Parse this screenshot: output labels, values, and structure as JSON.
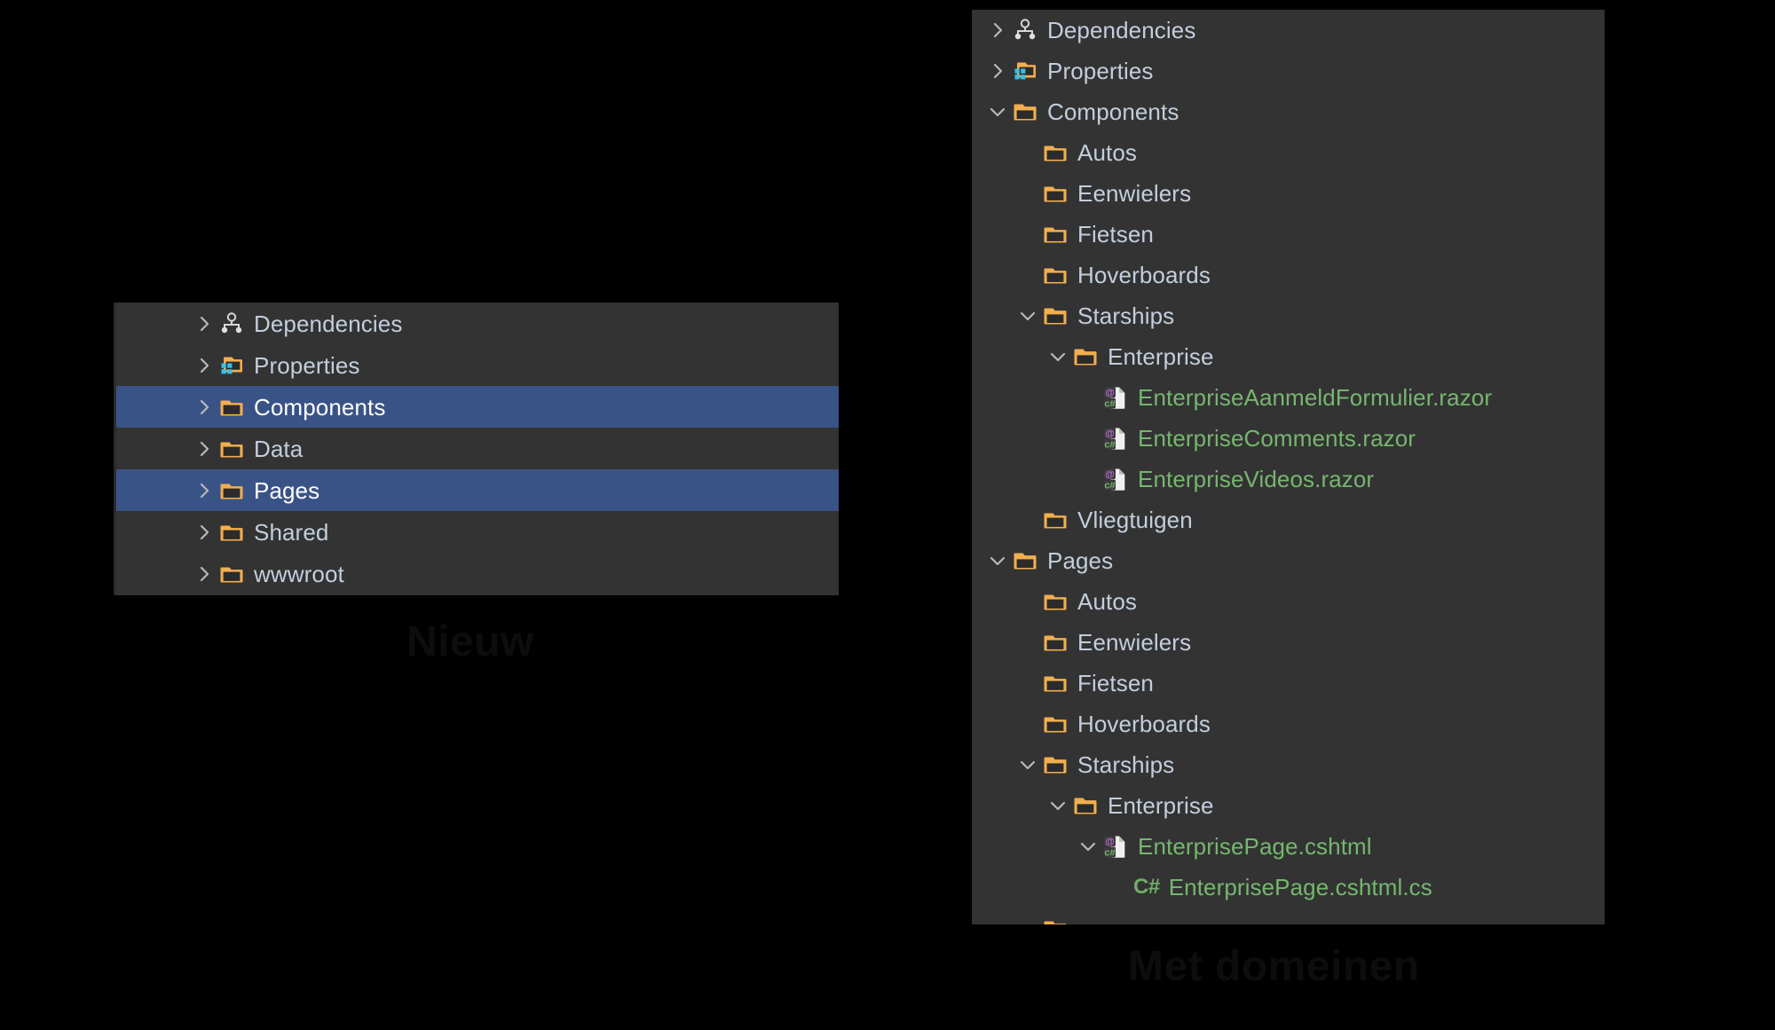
{
  "colors": {
    "background": "#000000",
    "panel_background": "#333333",
    "selection_blue": "#3a5387",
    "folder_orange": "#f2ae4f",
    "text_default": "#c3cedd",
    "text_selected": "#ffffff",
    "file_green": "#76b66f",
    "razor_purple": "#c06fd6",
    "properties_cyan": "#39c0e8",
    "caption_text": "#0d0d0d"
  },
  "captions": {
    "left": "Nieuw",
    "right": "Met domeinen"
  },
  "panel_new": {
    "title": "Nieuw",
    "rows": [
      {
        "label": "Dependencies",
        "icon": "dependencies-icon",
        "chevron": "collapsed",
        "depth": 0,
        "selected": false
      },
      {
        "label": "Properties",
        "icon": "properties-folder-icon",
        "chevron": "collapsed",
        "depth": 0,
        "selected": false
      },
      {
        "label": "Components",
        "icon": "folder-icon",
        "chevron": "collapsed",
        "depth": 0,
        "selected": true
      },
      {
        "label": "Data",
        "icon": "folder-icon",
        "chevron": "collapsed",
        "depth": 0,
        "selected": false
      },
      {
        "label": "Pages",
        "icon": "folder-icon",
        "chevron": "collapsed",
        "depth": 0,
        "selected": true
      },
      {
        "label": "Shared",
        "icon": "folder-icon",
        "chevron": "collapsed",
        "depth": 0,
        "selected": false
      },
      {
        "label": "wwwroot",
        "icon": "folder-icon",
        "chevron": "collapsed",
        "depth": 0,
        "selected": false
      }
    ]
  },
  "panel_domains": {
    "title": "Met domeinen",
    "rows": [
      {
        "label": "Dependencies",
        "icon": "dependencies-icon",
        "chevron": "collapsed",
        "depth": 0,
        "selected": false
      },
      {
        "label": "Properties",
        "icon": "properties-folder-icon",
        "chevron": "collapsed",
        "depth": 0,
        "selected": false
      },
      {
        "label": "Components",
        "icon": "folder-open-icon",
        "chevron": "expanded",
        "depth": 0,
        "selected": false
      },
      {
        "label": "Autos",
        "icon": "folder-icon",
        "chevron": "none",
        "depth": 1,
        "selected": false
      },
      {
        "label": "Eenwielers",
        "icon": "folder-icon",
        "chevron": "none",
        "depth": 1,
        "selected": false
      },
      {
        "label": "Fietsen",
        "icon": "folder-icon",
        "chevron": "none",
        "depth": 1,
        "selected": false
      },
      {
        "label": "Hoverboards",
        "icon": "folder-icon",
        "chevron": "none",
        "depth": 1,
        "selected": false
      },
      {
        "label": "Starships",
        "icon": "folder-open-icon",
        "chevron": "expanded",
        "depth": 1,
        "selected": false
      },
      {
        "label": "Enterprise",
        "icon": "folder-open-icon",
        "chevron": "expanded",
        "depth": 2,
        "selected": false
      },
      {
        "label": "EnterpriseAanmeldFormulier.razor",
        "icon": "razor-file-icon",
        "chevron": "none",
        "depth": 3,
        "selected": false,
        "green": true
      },
      {
        "label": "EnterpriseComments.razor",
        "icon": "razor-file-icon",
        "chevron": "none",
        "depth": 3,
        "selected": false,
        "green": true
      },
      {
        "label": "EnterpriseVideos.razor",
        "icon": "razor-file-icon",
        "chevron": "none",
        "depth": 3,
        "selected": false,
        "green": true
      },
      {
        "label": "Vliegtuigen",
        "icon": "folder-icon",
        "chevron": "none",
        "depth": 1,
        "selected": false
      },
      {
        "label": "Pages",
        "icon": "folder-open-icon",
        "chevron": "expanded",
        "depth": 0,
        "selected": false
      },
      {
        "label": "Autos",
        "icon": "folder-icon",
        "chevron": "none",
        "depth": 1,
        "selected": false
      },
      {
        "label": "Eenwielers",
        "icon": "folder-icon",
        "chevron": "none",
        "depth": 1,
        "selected": false
      },
      {
        "label": "Fietsen",
        "icon": "folder-icon",
        "chevron": "none",
        "depth": 1,
        "selected": false
      },
      {
        "label": "Hoverboards",
        "icon": "folder-icon",
        "chevron": "none",
        "depth": 1,
        "selected": false
      },
      {
        "label": "Starships",
        "icon": "folder-open-icon",
        "chevron": "expanded",
        "depth": 1,
        "selected": false
      },
      {
        "label": "Enterprise",
        "icon": "folder-open-icon",
        "chevron": "expanded",
        "depth": 2,
        "selected": false
      },
      {
        "label": "EnterprisePage.cshtml",
        "icon": "razor-file-icon",
        "chevron": "expanded",
        "depth": 3,
        "selected": false,
        "green": true
      },
      {
        "label": "EnterprisePage.cshtml.cs",
        "icon": "csharp-text-icon",
        "chevron": "none",
        "depth": 4,
        "selected": false,
        "green": true,
        "badge": "C#"
      },
      {
        "label": "",
        "icon": "folder-icon",
        "chevron": "none",
        "depth": 1,
        "selected": false,
        "clipped": true
      }
    ]
  }
}
